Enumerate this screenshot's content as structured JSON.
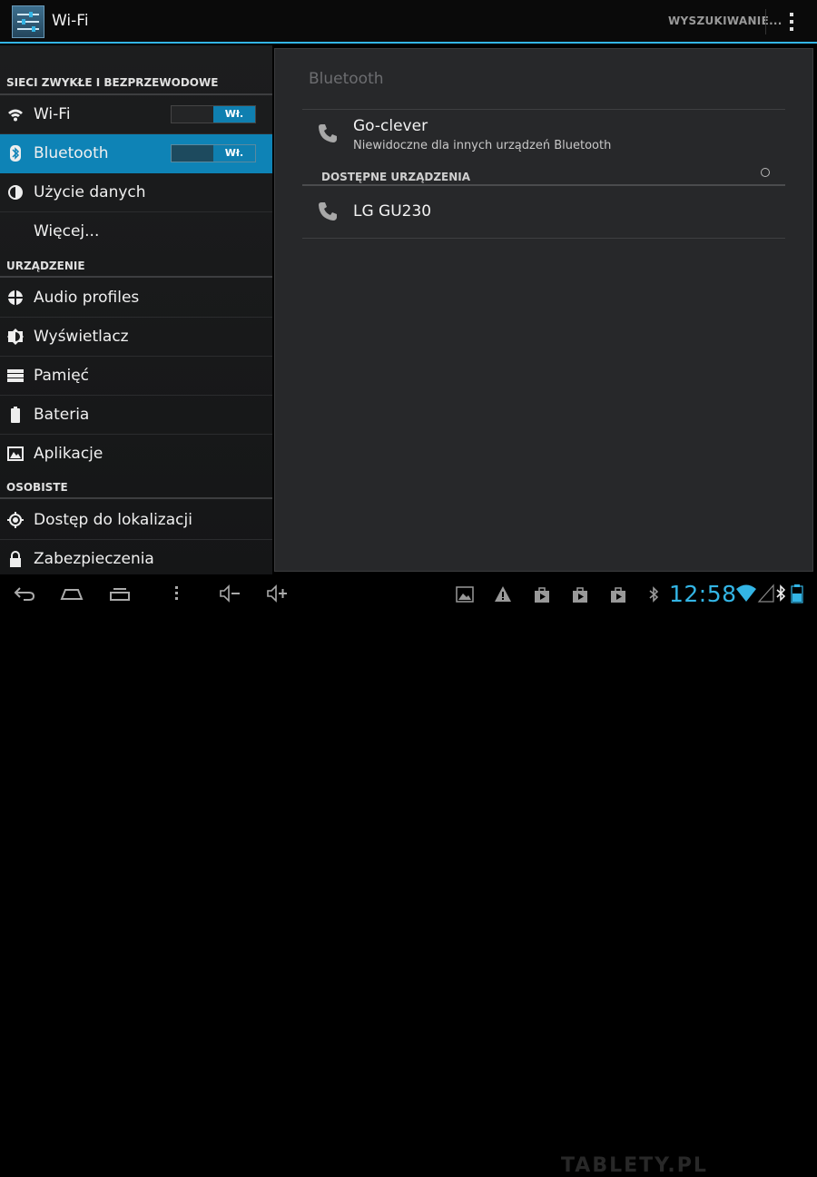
{
  "action_bar": {
    "title": "Wi-Fi",
    "search_label": "WYSZUKIWANIE..."
  },
  "sidebar": {
    "sections": [
      {
        "header": "SIECI ZWYKŁE I BEZPRZEWODOWE"
      },
      {
        "header": "URZĄDZENIE"
      },
      {
        "header": "OSOBISTE"
      }
    ],
    "items": [
      {
        "label": "Wi-Fi",
        "icon": "wifi-icon",
        "toggle": "Wł."
      },
      {
        "label": "Bluetooth",
        "icon": "bluetooth-icon",
        "toggle": "Wł.",
        "selected": true
      },
      {
        "label": "Użycie danych",
        "icon": "data-usage-icon"
      },
      {
        "label": "Więcej..."
      },
      {
        "label": "Audio profiles",
        "icon": "audio-profiles-icon"
      },
      {
        "label": "Wyświetlacz",
        "icon": "display-icon"
      },
      {
        "label": "Pamięć",
        "icon": "storage-icon"
      },
      {
        "label": "Bateria",
        "icon": "battery-icon"
      },
      {
        "label": "Aplikacje",
        "icon": "apps-icon"
      },
      {
        "label": "Dostęp do lokalizacji",
        "icon": "location-icon"
      },
      {
        "label": "Zabezpieczenia",
        "icon": "lock-icon"
      }
    ]
  },
  "detail": {
    "title": "Bluetooth",
    "this_device": {
      "name": "Go-clever",
      "status": "Niewidoczne dla innych urządzeń Bluetooth",
      "icon": "phone-icon"
    },
    "available_header": "DOSTĘPNE URZĄDZENIA",
    "available_devices": [
      {
        "name": "LG GU230",
        "icon": "phone-icon"
      }
    ]
  },
  "system_bar": {
    "clock": "12:58",
    "nav_buttons": [
      "back-icon",
      "home-icon",
      "recent-apps-icon",
      "menu-icon",
      "volume-down-icon",
      "volume-up-icon"
    ],
    "notification_icons": [
      "gallery-icon",
      "warning-icon",
      "shopping-bag-icon",
      "play-store-icon",
      "play-store-icon",
      "bluetooth-icon"
    ],
    "status_icons": [
      "wifi-signal-icon",
      "cell-signal-icon",
      "bluetooth-status-icon",
      "battery-status-icon"
    ],
    "accent_color": "#33b5e5"
  },
  "watermark": "TABLETY.PL"
}
